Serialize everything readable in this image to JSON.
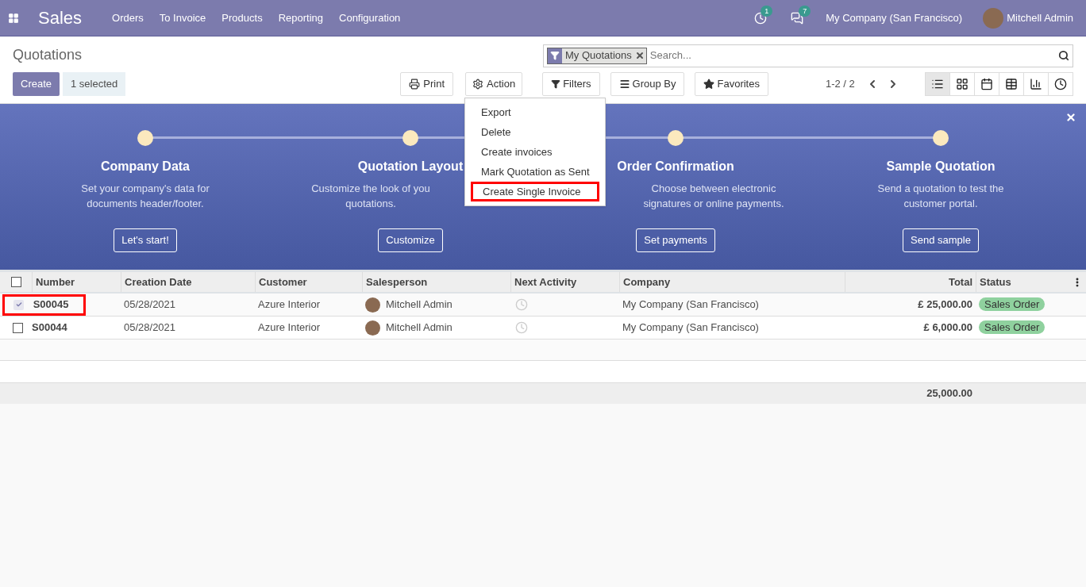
{
  "navbar": {
    "app_name": "Sales",
    "menu": [
      "Orders",
      "To Invoice",
      "Products",
      "Reporting",
      "Configuration"
    ],
    "activity_count": "1",
    "message_count": "7",
    "company": "My Company (San Francisco)",
    "user": "Mitchell Admin"
  },
  "control_panel": {
    "title": "Quotations",
    "create": "Create",
    "selection": "1 selected",
    "print": "Print",
    "action": "Action",
    "search": {
      "facet": "My Quotations",
      "placeholder": "Search..."
    },
    "filters": "Filters",
    "group_by": "Group By",
    "favorites": "Favorites",
    "pager": "1-2 / 2",
    "views": [
      {
        "kind": "list",
        "selected": true
      },
      {
        "kind": "kanban",
        "selected": false
      },
      {
        "kind": "calendar",
        "selected": false
      },
      {
        "kind": "pivot",
        "selected": false
      },
      {
        "kind": "graph",
        "selected": false
      },
      {
        "kind": "activity",
        "selected": false
      }
    ]
  },
  "action_menu": [
    {
      "label": "Export",
      "highlighted": false
    },
    {
      "label": "Delete",
      "highlighted": false
    },
    {
      "label": "Create invoices",
      "highlighted": false
    },
    {
      "label": "Mark Quotation as Sent",
      "highlighted": false
    },
    {
      "label": "Create Single Invoice",
      "highlighted": true
    }
  ],
  "onboarding": [
    {
      "title": "Company Data",
      "description": [
        "Set your company's data for",
        "documents header/footer."
      ],
      "button": "Let's start!"
    },
    {
      "title": "Quotation Layout",
      "description": [
        "Customize the look of you",
        "quotations."
      ],
      "button": "Customize"
    },
    {
      "title": "Order Confirmation",
      "description": [
        "Choose between electronic",
        "signatures or online payments."
      ],
      "button": "Set payments"
    },
    {
      "title": "Sample Quotation",
      "description": [
        "Send a quotation to test the",
        "customer portal."
      ],
      "button": "Send sample"
    }
  ],
  "table": {
    "all_selected": false,
    "columns": [
      "Number",
      "Creation Date",
      "Customer",
      "Salesperson",
      "Next Activity",
      "Company",
      "Total",
      "Status"
    ],
    "rows": [
      {
        "selected": true,
        "highlighted": true,
        "number": "S00045",
        "date": "05/28/2021",
        "customer": "Azure Interior",
        "salesperson": "Mitchell Admin",
        "company": "My Company (San Francisco)",
        "total": "£ 25,000.00",
        "status": "Sales Order"
      },
      {
        "selected": false,
        "highlighted": false,
        "number": "S00044",
        "date": "05/28/2021",
        "customer": "Azure Interior",
        "salesperson": "Mitchell Admin",
        "company": "My Company (San Francisco)",
        "total": "£ 6,000.00",
        "status": "Sales Order"
      }
    ],
    "footer_total": "25,000.00"
  }
}
